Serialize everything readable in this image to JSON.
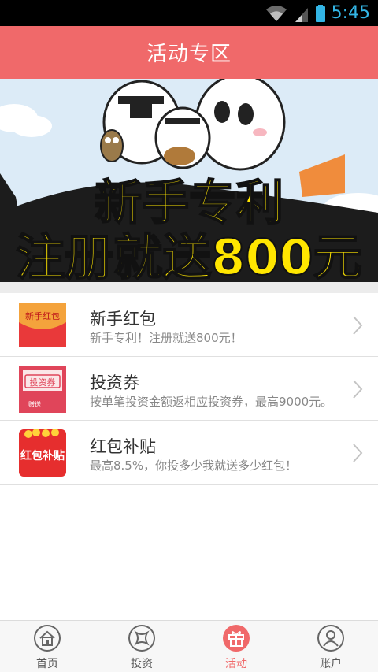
{
  "status_bar": {
    "time": "5:45"
  },
  "header": {
    "title": "活动专区"
  },
  "banner": {
    "line1": "新手专利",
    "line2": "注册就送800元"
  },
  "list": [
    {
      "thumb_text": "新手红包",
      "title": "新手红包",
      "desc": "新手专利！注册就送800元！"
    },
    {
      "thumb_text": "投资券",
      "thumb_sub": "赠送",
      "title": "投资券",
      "desc": "按单笔投资金额返相应投资券，最高9000元。"
    },
    {
      "thumb_text": "红包补贴",
      "title": "红包补贴",
      "desc": "最高8.5%，你投多少我就送多少红包！"
    }
  ],
  "tabs": [
    {
      "label": "首页",
      "icon": "home-icon"
    },
    {
      "label": "投资",
      "icon": "invest-icon"
    },
    {
      "label": "活动",
      "icon": "gift-icon",
      "active": true
    },
    {
      "label": "账户",
      "icon": "account-icon"
    }
  ],
  "colors": {
    "accent": "#f0696a",
    "status_time": "#33b5e5",
    "banner_text": "#ffe600"
  }
}
